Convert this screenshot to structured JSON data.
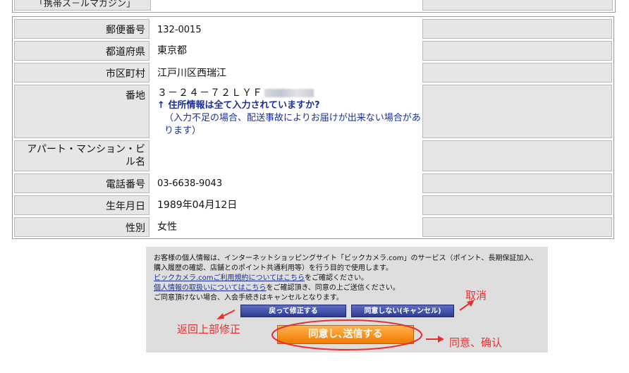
{
  "top_row": {
    "label": "「携帯ス－ルマガジン」"
  },
  "form": {
    "rows": [
      {
        "label": "郵便番号",
        "value": "132-0015"
      },
      {
        "label": "都道府県",
        "value": "東京都"
      },
      {
        "label": "市区町村",
        "value": "江戸川区西瑞江"
      },
      {
        "label": "番地",
        "value": "３－２４－７２ＬＹＦ"
      },
      {
        "label": "アパート・マンション・ビル名",
        "value": ""
      },
      {
        "label": "電話番号",
        "value": "03-6638-9043"
      },
      {
        "label": "生年月日",
        "value": "1989年04月12日"
      },
      {
        "label": "性別",
        "value": "女性"
      }
    ],
    "address_notice": {
      "arrow": "↑",
      "title": "住所情報は全て入力されていますか?",
      "detail": "（入力不足の場合、配送事故によりお届けが出来ない場合があります）"
    }
  },
  "consent": {
    "line1": "お客様の個人情報は、インターネットショッピングサイト「ビックカメラ.com」のサービス（ポイント、長期保証加入、購入履歴の確認、店舗とのポイント共通利用等）を行う目的で使用します。",
    "link1": "ビックカメラ.comご利用規約についてはこちら",
    "line2_suffix": "をご確認ください。",
    "link2": "個人情報の取扱いについてはこちら",
    "line3_suffix": "をご確認頂き、同意の上ご送信ください。",
    "line4": "ご同意頂けない場合、入会手続きはキャンセルとなります。",
    "btn_back": "戻って修正する",
    "btn_cancel": "同意しない(キャンセル)",
    "btn_agree": "同意し､送信する"
  },
  "annotations": {
    "cancel": "取消",
    "back": "返回上部修正",
    "agree": "同意、确认",
    "color": "#e83030"
  }
}
